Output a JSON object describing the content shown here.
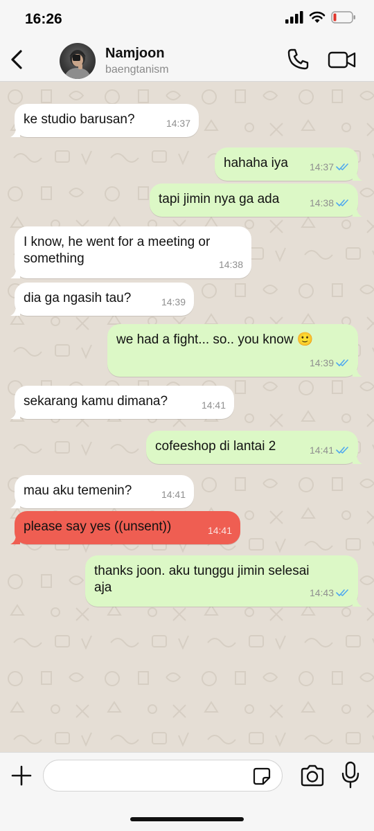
{
  "status_bar": {
    "time": "16:26"
  },
  "header": {
    "contact_name": "Namjoon",
    "contact_subtitle": "baengtanism",
    "icons": [
      "back-icon",
      "phone-icon",
      "video-icon"
    ]
  },
  "messages": [
    {
      "direction": "in",
      "text": "ke studio barusan?",
      "time": "14:37"
    },
    {
      "direction": "out",
      "text": "hahaha iya",
      "time": "14:37",
      "read": true
    },
    {
      "direction": "out",
      "text": "tapi jimin nya ga ada",
      "time": "14:38",
      "read": true
    },
    {
      "direction": "in",
      "text": "I know, he went for a meeting or\nsomething",
      "time": "14:38"
    },
    {
      "direction": "in",
      "text": "dia ga ngasih tau?",
      "time": "14:39"
    },
    {
      "direction": "out",
      "text": "we had a fight... so.. you know 🙂",
      "time": "14:39",
      "read": true
    },
    {
      "direction": "in",
      "text": "sekarang kamu dimana?",
      "time": "14:41"
    },
    {
      "direction": "out",
      "text": "cofeeshop di lantai 2",
      "time": "14:41",
      "read": true
    },
    {
      "direction": "in",
      "text": "mau aku temenin?",
      "time": "14:41"
    },
    {
      "direction": "in",
      "text": "please say yes ((unsent))",
      "time": "14:41",
      "highlight": "#ef5e52"
    },
    {
      "direction": "out",
      "text": "thanks joon. aku tunggu jimin selesai\naja",
      "time": "14:43",
      "read": true
    }
  ],
  "input_bar": {
    "placeholder": "",
    "icons": [
      "plus-icon",
      "sticker-icon",
      "camera-icon",
      "mic-icon"
    ]
  },
  "colors": {
    "outgoing_bubble": "#dcf8c6",
    "incoming_bubble": "#ffffff",
    "chat_background": "#e5ded5",
    "read_tick": "#4fa8ef",
    "unsent_bubble": "#ef5e52"
  }
}
